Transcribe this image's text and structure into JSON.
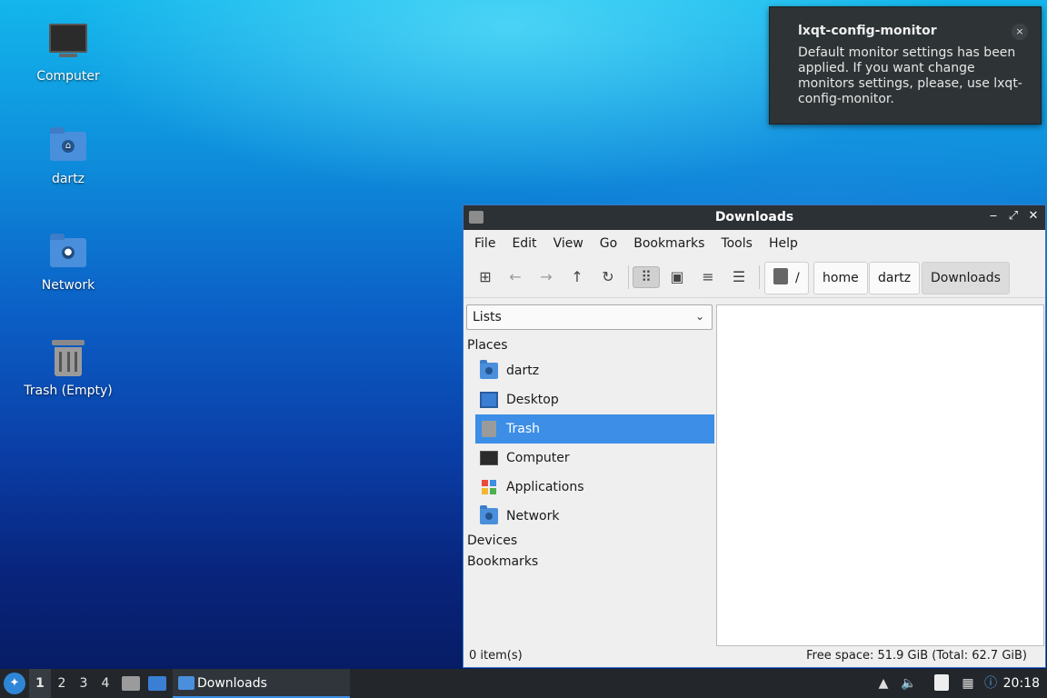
{
  "desktop": {
    "icons": [
      {
        "label": "Computer"
      },
      {
        "label": "dartz"
      },
      {
        "label": "Network"
      },
      {
        "label": "Trash (Empty)"
      }
    ]
  },
  "notification": {
    "title": "lxqt-config-monitor",
    "body": "Default monitor settings has been applied. If you want change monitors settings, please, use lxqt-config-monitor.",
    "close_glyph": "×"
  },
  "window": {
    "title": "Downloads",
    "controls": {
      "minimize": "‒",
      "maximize": "⤢",
      "close": "✕"
    },
    "menu": [
      "File",
      "Edit",
      "View",
      "Go",
      "Bookmarks",
      "Tools",
      "Help"
    ],
    "toolbar": {
      "new_tab": "⊞",
      "back": "←",
      "forward": "→",
      "up": "↑",
      "reload": "↻",
      "view_icons": "⠿",
      "view_thumbnails": "▣",
      "view_compact": "≡",
      "view_details": "☰"
    },
    "breadcrumbs": [
      "/",
      "home",
      "dartz",
      "Downloads"
    ],
    "sidepane": {
      "mode": "Lists",
      "places_header": "Places",
      "places": [
        {
          "label": "dartz",
          "icon": "home-folder-icon"
        },
        {
          "label": "Desktop",
          "icon": "desktop-icon"
        },
        {
          "label": "Trash",
          "icon": "trash-icon",
          "selected": true
        },
        {
          "label": "Computer",
          "icon": "computer-icon"
        },
        {
          "label": "Applications",
          "icon": "applications-icon"
        },
        {
          "label": "Network",
          "icon": "network-icon"
        }
      ],
      "devices_header": "Devices",
      "bookmarks_header": "Bookmarks"
    },
    "status": {
      "items": "0 item(s)",
      "free_space": "Free space: 51.9 GiB (Total: 62.7 GiB)"
    }
  },
  "taskbar": {
    "workspaces": [
      "1",
      "2",
      "3",
      "4"
    ],
    "current_workspace": "1",
    "task_label": "Downloads",
    "clock": "20:18"
  },
  "colors": {
    "selection": "#3d8ee6",
    "titlebar": "#2c3136",
    "taskbar": "#23272b"
  }
}
